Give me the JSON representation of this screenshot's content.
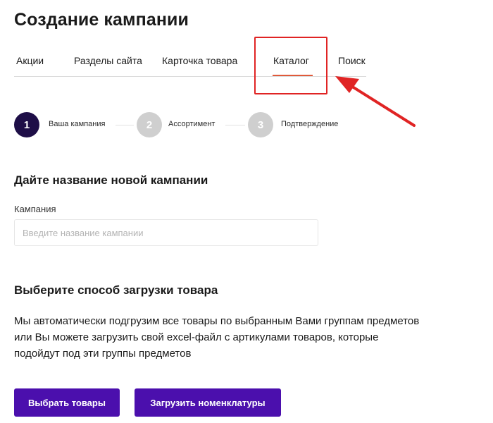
{
  "page": {
    "title": "Создание кампании"
  },
  "tabs": [
    {
      "label": "Акции"
    },
    {
      "label": "Разделы сайта"
    },
    {
      "label": "Карточка товара"
    },
    {
      "label": "Каталог",
      "active": true
    },
    {
      "label": "Поиск"
    }
  ],
  "stepper": [
    {
      "number": "1",
      "label": "Ваша кампания",
      "active": true
    },
    {
      "number": "2",
      "label": "Ассортимент",
      "active": false
    },
    {
      "number": "3",
      "label": "Подтверждение",
      "active": false
    }
  ],
  "name_section": {
    "heading": "Дайте название новой кампании",
    "field_label": "Кампания",
    "placeholder": "Введите название кампании",
    "value": ""
  },
  "upload_section": {
    "heading": "Выберите способ загрузки товара",
    "description": "Мы автоматически подгрузим все товары по выбранным Вами группам предметов или Вы можете загрузить свой excel-файл с артикулами товаров, которые подойдут под эти группы предметов"
  },
  "buttons": {
    "select_goods": "Выбрать товары",
    "upload_nomenclature": "Загрузить номенклатуры"
  },
  "colors": {
    "accent": "#4b0fad",
    "step_active": "#1e0e47",
    "step_inactive": "#cfcfcf",
    "tab_underline": "#e05a3a",
    "annotation": "#e02424"
  }
}
